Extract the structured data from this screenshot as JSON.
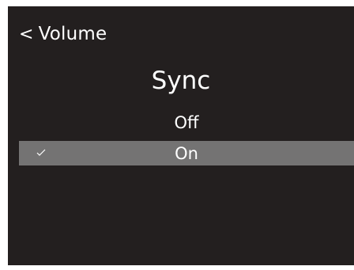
{
  "header": {
    "back_label": "Volume",
    "back_icon": "chevron-left-icon"
  },
  "title": "Sync",
  "options": [
    {
      "label": "Off",
      "selected": false
    },
    {
      "label": "On",
      "selected": true
    }
  ],
  "colors": {
    "background": "#231f1f",
    "selected_row": "#747373",
    "text": "#ffffff"
  }
}
